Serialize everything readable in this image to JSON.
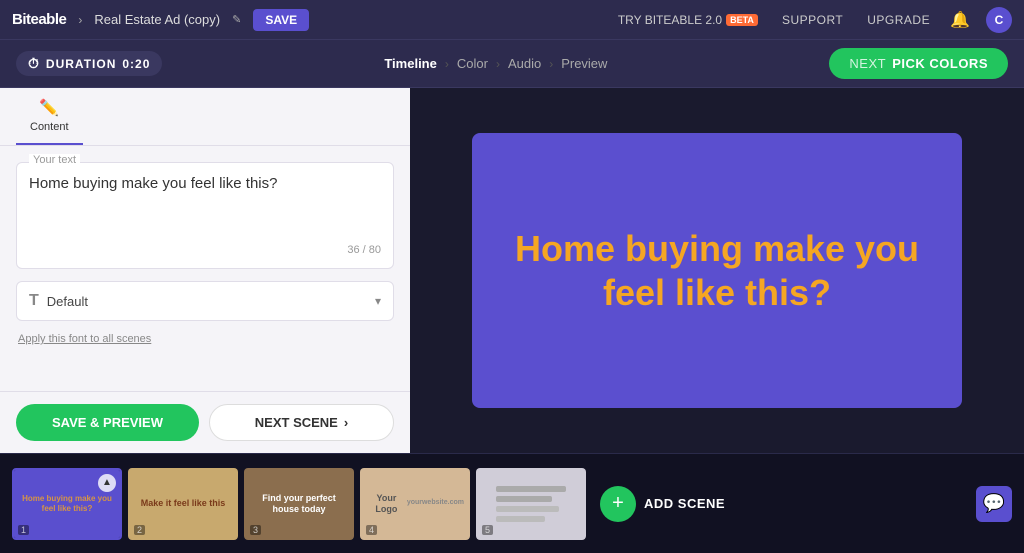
{
  "topnav": {
    "brand": "Biteable",
    "project_title": "Real Estate Ad (copy)",
    "save_label": "SAVE",
    "try_label": "TRY BITEABLE 2.0",
    "beta_label": "BETA",
    "support_label": "SUPPORT",
    "upgrade_label": "UPGRADE",
    "avatar_letter": "C"
  },
  "timeline_bar": {
    "duration_label": "DURATION",
    "duration_value": "0:20",
    "steps": [
      {
        "label": "Timeline",
        "active": true
      },
      {
        "label": "Color",
        "active": false
      },
      {
        "label": "Audio",
        "active": false
      },
      {
        "label": "Preview",
        "active": false
      }
    ],
    "next_label": "NeXT",
    "pick_colors_label": "Pick colors"
  },
  "left_panel": {
    "tabs": [
      {
        "label": "Content",
        "icon": "✏️",
        "active": true
      }
    ],
    "text_field": {
      "label": "Your text",
      "value": "Home buying make you feel like this?",
      "char_current": "36",
      "char_max": "80"
    },
    "font_select": {
      "icon": "T",
      "value": "Default",
      "chevron": "▾"
    },
    "apply_font_label": "Apply this font to all scenes",
    "footer": {
      "save_preview_label": "SAVE & PREVIEW",
      "next_scene_label": "NEXT SCENE",
      "next_arrow": "›"
    }
  },
  "preview": {
    "text": "Home buying make you feel like this?",
    "bg_color": "#5b4fcf",
    "text_color": "#f5a623"
  },
  "filmstrip": {
    "add_scene_label": "ADD SCENE",
    "thumbs": [
      {
        "id": 1,
        "active": true,
        "bg": "thumb1-bg",
        "text": "Home buying make you feel like this?",
        "has_scroll": true
      },
      {
        "id": 2,
        "active": false,
        "bg": "thumb2-bg",
        "text": "Make it feel like this"
      },
      {
        "id": 3,
        "active": false,
        "bg": "thumb3-bg",
        "text": "Find your perfect house today"
      },
      {
        "id": 4,
        "active": false,
        "bg": "thumb4-bg",
        "text": "Your Logo"
      },
      {
        "id": 5,
        "active": false,
        "bg": "thumb5-bg",
        "text": ""
      }
    ]
  }
}
